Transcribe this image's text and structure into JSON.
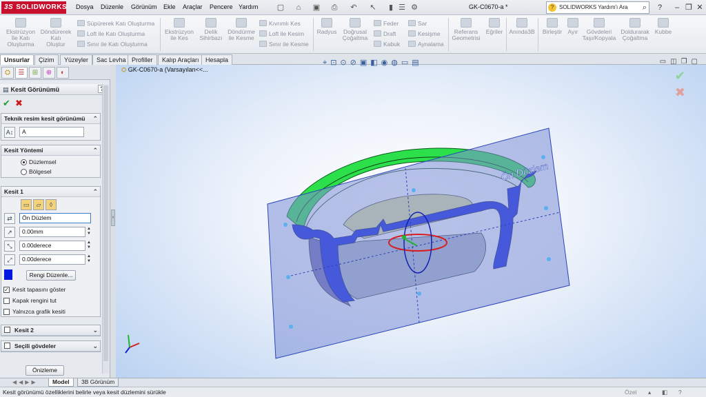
{
  "app": {
    "logo": "SOLIDWORKS",
    "logo_mark": "3S",
    "doc_title": "GK-C0670-a *"
  },
  "menu": [
    "Dosya",
    "Düzenle",
    "Görünüm",
    "Ekle",
    "Araçlar",
    "Pencere",
    "Yardım"
  ],
  "help_search": {
    "placeholder": "SOLIDWORKS Yardım'ı Ara"
  },
  "ribbon": {
    "big_buttons": [
      {
        "label1": "Ekstrüzyon",
        "label2": "İle Katı",
        "label3": "Oluşturma"
      },
      {
        "label1": "Döndürerek",
        "label2": "Katı",
        "label3": "Oluştur"
      },
      {
        "label1": "Ekstrüzyon",
        "label2": "ile Kes",
        "label3": ""
      },
      {
        "label1": "Delik",
        "label2": "Sihirbazı",
        "label3": ""
      },
      {
        "label1": "Döndürme",
        "label2": "ile Kesme",
        "label3": ""
      },
      {
        "label1": "Radyus",
        "label2": "",
        "label3": ""
      },
      {
        "label1": "Doğrusal",
        "label2": "Çoğaltma",
        "label3": ""
      },
      {
        "label1": "Referans",
        "label2": "Geometrisi",
        "label3": ""
      },
      {
        "label1": "Eğriler",
        "label2": "",
        "label3": ""
      },
      {
        "label1": "Anında3B",
        "label2": "",
        "label3": ""
      },
      {
        "label1": "Birleştir",
        "label2": "",
        "label3": ""
      },
      {
        "label1": "Ayır",
        "label2": "",
        "label3": ""
      },
      {
        "label1": "Gövdeleri",
        "label2": "Taşı/Kopyala",
        "label3": ""
      },
      {
        "label1": "Doldurarak",
        "label2": "Çoğaltma",
        "label3": ""
      },
      {
        "label1": "Kubbe",
        "label2": "",
        "label3": ""
      }
    ],
    "small_buttons": [
      "Süpürerek Katı Oluşturma",
      "Loft ile Katı Oluşturma",
      "Sınır ile Katı Oluşturma",
      "Kıvrımlı Kes",
      "Loft ile Kesim",
      "Sınır ile Kesme",
      "Feder",
      "Draft",
      "Kabuk",
      "Sar",
      "Kesişme",
      "Aynalama"
    ]
  },
  "tabs": [
    "Unsurlar",
    "Çizim",
    "Yüzeyler",
    "Sac Levha",
    "Profiller",
    "Kalıp Araçları",
    "Hesapla"
  ],
  "tree": {
    "root_label": "GK-C0670-a  (Varsayılan<<..."
  },
  "panel": {
    "title": "Kesit Görünümü",
    "ok": "✔",
    "cancel": "✖",
    "help": "?",
    "section_drawing": {
      "title": "Teknik resim kesit görünümü",
      "value": "A"
    },
    "section_method": {
      "title": "Kesit Yöntemi",
      "options": [
        "Düzlemsel",
        "Bölgesel"
      ],
      "selected": "Düzlemsel"
    },
    "section1": {
      "title": "Kesit 1",
      "plane": "Ön Düzlem",
      "offset": "0.00mm",
      "rot_x": "0.00derece",
      "rot_y": "0.00derece",
      "color_button": "Rengi Düzenle...",
      "checks": [
        {
          "label": "Kesit tapasını göster",
          "checked": true
        },
        {
          "label": "Kapak rengini tut",
          "checked": false
        },
        {
          "label": "Yalnızca grafik kesiti",
          "checked": false
        }
      ]
    },
    "section2": {
      "title": "Kesit 2"
    },
    "selected_bodies": {
      "title": "Seçili gövdeler"
    },
    "preview_button": "Önizleme"
  },
  "viewport": {
    "plane_label": "Ön Düzlem"
  },
  "bottom_tabs": [
    "Model",
    "3B Görünüm"
  ],
  "status": {
    "message": "Kesit görünümü özelliklerini belirle veya kesit düzlemini sürükle",
    "mode": "Özel"
  },
  "colors": {
    "brand": "#c8102e",
    "accent_green": "#22dd44",
    "section_blue": "#0018e0",
    "plane": "#7d8fd6"
  }
}
